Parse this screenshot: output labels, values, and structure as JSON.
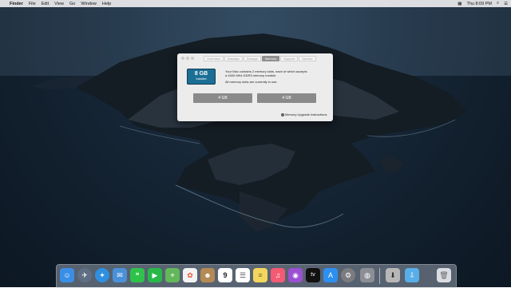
{
  "menubar": {
    "apple": "",
    "app_name": "Finder",
    "items": [
      "File",
      "Edit",
      "View",
      "Go",
      "Window",
      "Help"
    ],
    "clock": "Thu 8:09 PM"
  },
  "about_window": {
    "tabs": [
      "Overview",
      "Displays",
      "Storage",
      "Memory",
      "Support",
      "Service"
    ],
    "active_tab": "Memory",
    "ram_size": "8 GB",
    "ram_status": "Installed",
    "info_line1": "Your Mac contains 2 memory slots, each of which accepts",
    "info_line2": "a 1600 MHz DDR3 memory module.",
    "info_line3": "All memory slots are currently in use.",
    "slots": [
      "4 GB",
      "4 GB"
    ],
    "upgrade_link": "Memory Upgrade Instructions"
  },
  "dock": {
    "icons": [
      "finder-icon",
      "launchpad-icon",
      "safari-icon",
      "mail-icon",
      "messages-icon",
      "facetime-icon",
      "maps-icon",
      "photos-icon",
      "contacts-icon",
      "calendar-icon",
      "reminders-icon",
      "notes-icon",
      "music-icon",
      "podcasts-icon",
      "tv-icon",
      "app-store-icon",
      "system-preferences-icon",
      "disk-utility-icon",
      "installer-icon",
      "downloads-folder-icon",
      "trash-icon"
    ],
    "calendar_day": "9",
    "tv_label": "tv",
    "colors": {
      "finder": "#3a8ee6",
      "launchpad": "#5f6f83",
      "safari": "#2f8fe0",
      "mail": "#4a90d9",
      "messages": "#2fc24b",
      "facetime": "#28b84a",
      "maps": "#62b75a",
      "photos": "#f2f2f2",
      "contacts": "#b58a54",
      "calendar": "#ffffff",
      "reminders": "#ffffff",
      "notes": "#f4d65d",
      "music": "#f45a74",
      "podcasts": "#9b4fd1",
      "tv": "#111111",
      "app_store": "#2d8ff0",
      "system_preferences": "#7c7c80",
      "disk_utility": "#8b8f95",
      "installer": "#b7b7b7",
      "downloads": "#58aee8",
      "trash": "#d9dde2"
    }
  }
}
